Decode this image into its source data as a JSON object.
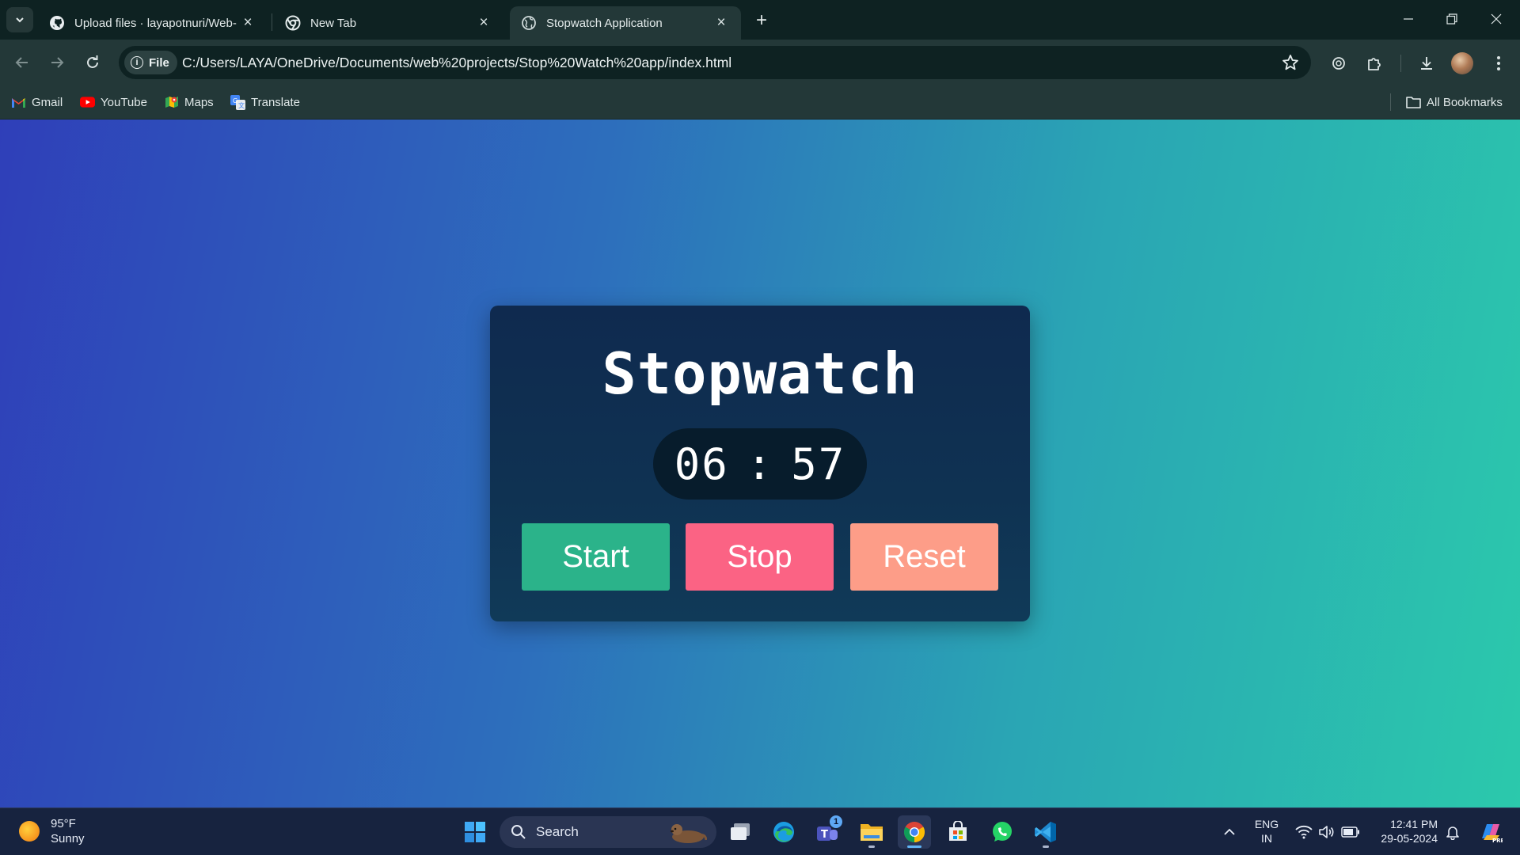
{
  "browser": {
    "tabs": [
      {
        "title": "Upload files · layapotnuri/Web-",
        "icon": "github-icon",
        "active": false
      },
      {
        "title": "New Tab",
        "icon": "chrome-icon",
        "active": false
      },
      {
        "title": "Stopwatch Application",
        "icon": "globe-icon",
        "active": true
      }
    ],
    "url_chip": "File",
    "url": "C:/Users/LAYA/OneDrive/Documents/web%20projects/Stop%20Watch%20app/index.html",
    "bookmarks": [
      {
        "label": "Gmail",
        "icon": "gmail-icon"
      },
      {
        "label": "YouTube",
        "icon": "youtube-icon"
      },
      {
        "label": "Maps",
        "icon": "maps-icon"
      },
      {
        "label": "Translate",
        "icon": "translate-icon"
      }
    ],
    "all_bookmarks": "All Bookmarks"
  },
  "stopwatch": {
    "title": "Stopwatch",
    "minutes": "06",
    "separator": ":",
    "seconds": "57",
    "buttons": {
      "start": "Start",
      "stop": "Stop",
      "reset": "Reset"
    }
  },
  "taskbar": {
    "weather_temp": "95°F",
    "weather_desc": "Sunny",
    "search_label": "Search",
    "teams_badge": "1",
    "lang_top": "ENG",
    "lang_bottom": "IN",
    "time": "12:41 PM",
    "date": "29-05-2024"
  },
  "colors": {
    "page_gradient": [
      "#2f3fb9",
      "#2bc9ac"
    ],
    "card_bg": "#0f2f50",
    "timer_bg": "#071c2c",
    "start": "#2bb38a",
    "stop": "#fb6384",
    "reset": "#fd9d88"
  }
}
